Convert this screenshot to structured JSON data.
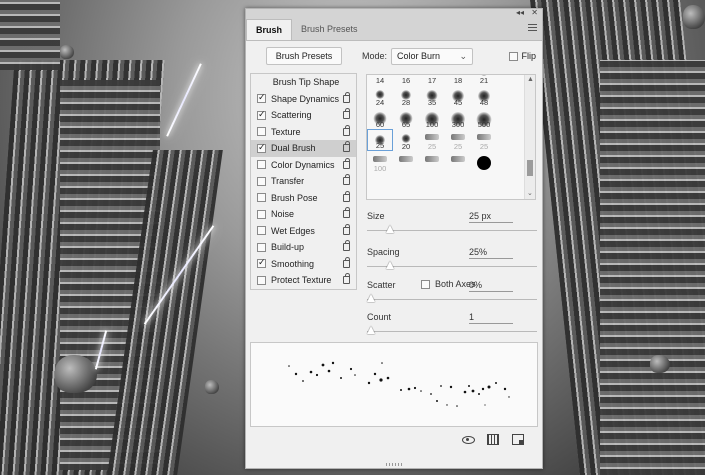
{
  "panel": {
    "tabs": [
      "Brush",
      "Brush Presets"
    ],
    "active_tab": "Brush",
    "brush_presets_button": "Brush Presets",
    "mode_label": "Mode:",
    "mode_value": "Color Burn",
    "flip_label": "Flip",
    "flip_checked": false
  },
  "settings": [
    {
      "label": "Brush Tip Shape",
      "header": true
    },
    {
      "label": "Shape Dynamics",
      "checked": true,
      "locked": true
    },
    {
      "label": "Scattering",
      "checked": true,
      "locked": true
    },
    {
      "label": "Texture",
      "checked": false,
      "locked": true
    },
    {
      "label": "Dual Brush",
      "checked": true,
      "locked": true,
      "selected": true
    },
    {
      "label": "Color Dynamics",
      "checked": false,
      "locked": true
    },
    {
      "label": "Transfer",
      "checked": false,
      "locked": true
    },
    {
      "label": "Brush Pose",
      "checked": false,
      "locked": true
    },
    {
      "label": "Noise",
      "checked": false,
      "locked": true
    },
    {
      "label": "Wet Edges",
      "checked": false,
      "locked": true
    },
    {
      "label": "Build-up",
      "checked": false,
      "locked": true
    },
    {
      "label": "Smoothing",
      "checked": true,
      "locked": true
    },
    {
      "label": "Protect Texture",
      "checked": false,
      "locked": true
    }
  ],
  "brush_tips": [
    {
      "size": "14"
    },
    {
      "size": "16"
    },
    {
      "size": "17"
    },
    {
      "size": "18"
    },
    {
      "size": "21"
    },
    {
      "size": ""
    },
    {
      "size": "24"
    },
    {
      "size": "28"
    },
    {
      "size": "35"
    },
    {
      "size": "45"
    },
    {
      "size": "48"
    },
    {
      "size": ""
    },
    {
      "size": "60"
    },
    {
      "size": "65"
    },
    {
      "size": "100"
    },
    {
      "size": "300"
    },
    {
      "size": "500"
    },
    {
      "size": ""
    },
    {
      "size": "25",
      "selected": true
    },
    {
      "size": "20"
    },
    {
      "size": "25",
      "stroke": true
    },
    {
      "size": "25",
      "stroke": true
    },
    {
      "size": "25",
      "stroke": true
    },
    {
      "size": ""
    },
    {
      "size": "100",
      "stroke": true
    },
    {
      "size": "",
      "stroke": true
    },
    {
      "size": "",
      "stroke": true
    },
    {
      "size": "",
      "stroke": true
    },
    {
      "size": "",
      "hard": true
    },
    {
      "size": ""
    }
  ],
  "size": {
    "label": "Size",
    "value": "25 px",
    "fraction": 0.11
  },
  "spacing": {
    "label": "Spacing",
    "value": "25%",
    "fraction": 0.11
  },
  "scatter": {
    "label": "Scatter",
    "both_axes_label": "Both Axes",
    "both_axes_checked": false,
    "value": "0%",
    "fraction": 0.0
  },
  "count": {
    "label": "Count",
    "value": "1",
    "fraction": 0.0
  },
  "bottom_icons": [
    "eye-icon",
    "grid-icon",
    "new-brush-icon"
  ]
}
